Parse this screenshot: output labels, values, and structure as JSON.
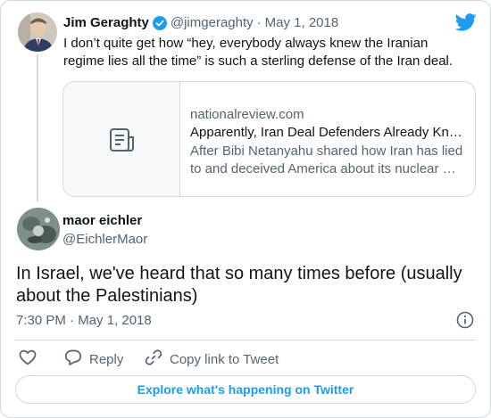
{
  "quoted_tweet": {
    "author_name": "Jim Geraghty",
    "handle": "@jimgeraghty",
    "separator": "·",
    "date": "May 1, 2018",
    "text": "I don’t quite get how “hey, everybody always knew the Iranian regime lies all the time” is such a sterling defense of the Iran deal.",
    "link_card": {
      "domain": "nationalreview.com",
      "title": "Apparently, Iran Deal Defenders Already Kn…",
      "description": "After Bibi Netanyahu shared how Iran has lied to and deceived America about its nuclear …"
    }
  },
  "reply_tweet": {
    "author_name": "maor eichler",
    "handle": "@EichlerMaor",
    "text": "In Israel, we've heard that so many times before (usually about the Palestinians)",
    "timestamp": "7:30 PM · May 1, 2018"
  },
  "actions": {
    "reply_label": "Reply",
    "copy_label": "Copy link to Tweet"
  },
  "explore_label": "Explore what's happening on Twitter",
  "colors": {
    "twitter_blue": "#1d9bf0",
    "muted": "#536471",
    "border": "#cfd9de"
  },
  "icons": [
    "twitter-bird-icon",
    "verified-badge-icon",
    "article-icon",
    "info-icon",
    "heart-icon",
    "reply-icon",
    "link-icon"
  ]
}
